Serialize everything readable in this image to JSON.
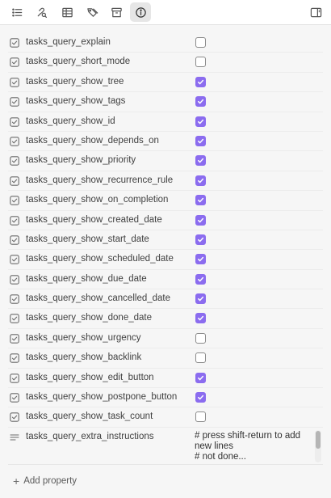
{
  "toolbar": {
    "buttons": [
      {
        "icon": "list-icon",
        "active": false
      },
      {
        "icon": "link-search-icon",
        "active": false
      },
      {
        "icon": "table-icon",
        "active": false
      },
      {
        "icon": "tags-icon",
        "active": false
      },
      {
        "icon": "archive-icon",
        "active": false
      },
      {
        "icon": "info-icon",
        "active": true
      }
    ],
    "right_icon": "sidebar-toggle-icon"
  },
  "properties": [
    {
      "name": "tasks_query_explain",
      "type": "checkbox",
      "checked": false
    },
    {
      "name": "tasks_query_short_mode",
      "type": "checkbox",
      "checked": false
    },
    {
      "name": "tasks_query_show_tree",
      "type": "checkbox",
      "checked": true
    },
    {
      "name": "tasks_query_show_tags",
      "type": "checkbox",
      "checked": true
    },
    {
      "name": "tasks_query_show_id",
      "type": "checkbox",
      "checked": true
    },
    {
      "name": "tasks_query_show_depends_on",
      "type": "checkbox",
      "checked": true
    },
    {
      "name": "tasks_query_show_priority",
      "type": "checkbox",
      "checked": true
    },
    {
      "name": "tasks_query_show_recurrence_rule",
      "type": "checkbox",
      "checked": true
    },
    {
      "name": "tasks_query_show_on_completion",
      "type": "checkbox",
      "checked": true
    },
    {
      "name": "tasks_query_show_created_date",
      "type": "checkbox",
      "checked": true
    },
    {
      "name": "tasks_query_show_start_date",
      "type": "checkbox",
      "checked": true
    },
    {
      "name": "tasks_query_show_scheduled_date",
      "type": "checkbox",
      "checked": true
    },
    {
      "name": "tasks_query_show_due_date",
      "type": "checkbox",
      "checked": true
    },
    {
      "name": "tasks_query_show_cancelled_date",
      "type": "checkbox",
      "checked": true
    },
    {
      "name": "tasks_query_show_done_date",
      "type": "checkbox",
      "checked": true
    },
    {
      "name": "tasks_query_show_urgency",
      "type": "checkbox",
      "checked": false
    },
    {
      "name": "tasks_query_show_backlink",
      "type": "checkbox",
      "checked": false
    },
    {
      "name": "tasks_query_show_edit_button",
      "type": "checkbox",
      "checked": true
    },
    {
      "name": "tasks_query_show_postpone_button",
      "type": "checkbox",
      "checked": true
    },
    {
      "name": "tasks_query_show_task_count",
      "type": "checkbox",
      "checked": false
    }
  ],
  "extra_instructions": {
    "name": "tasks_query_extra_instructions",
    "lines": [
      "# press shift-return to add",
      "new lines",
      "# not done..."
    ]
  },
  "add_property": {
    "icon": "plus-icon",
    "label": "Add property"
  },
  "colors": {
    "accent": "#8b6cef",
    "panel_bg": "#f6f6f6"
  }
}
